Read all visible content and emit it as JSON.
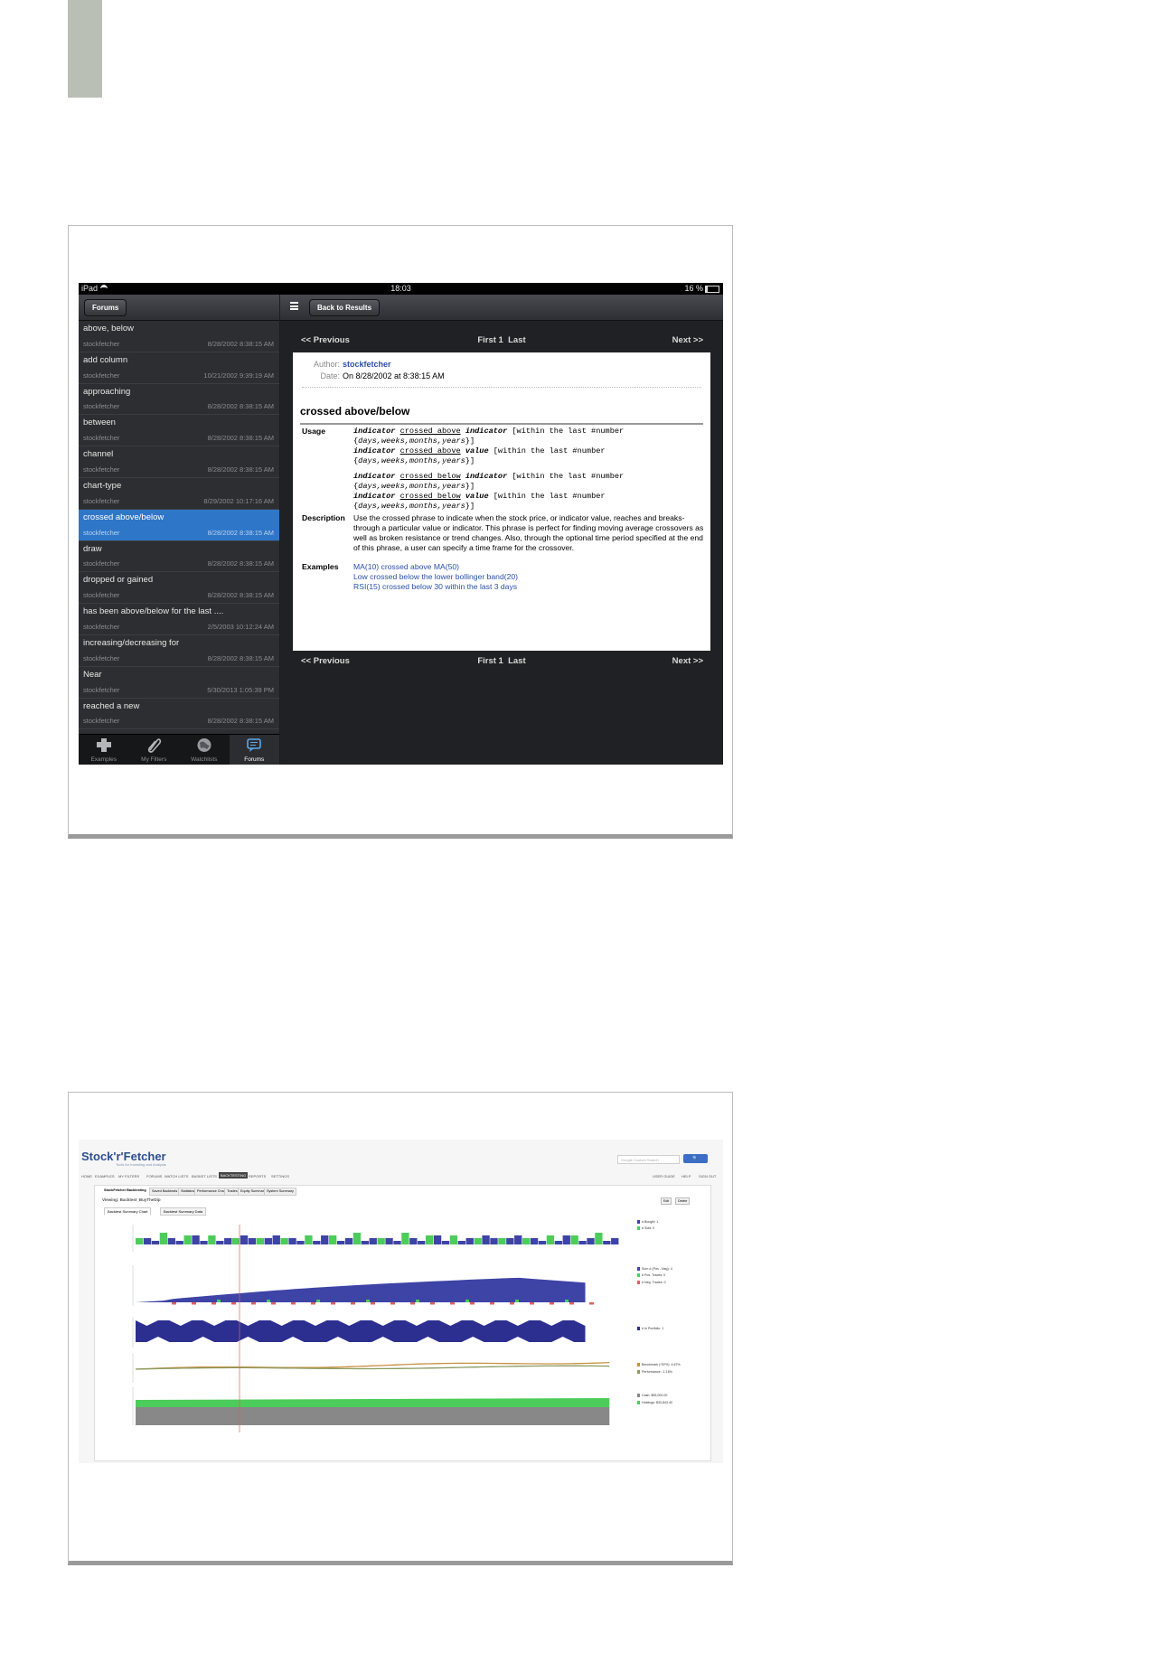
{
  "ipad": {
    "status": {
      "carrier": "iPad",
      "time": "18:03",
      "battery": "16 %"
    },
    "sidebar_header": "Forums",
    "back_button": "Back to Results",
    "items": [
      {
        "title": "above, below",
        "author": "stockfetcher",
        "date": "8/28/2002 8:38:15 AM"
      },
      {
        "title": "add column",
        "author": "stockfetcher",
        "date": "10/21/2002 9:39:19 AM"
      },
      {
        "title": "approaching",
        "author": "stockfetcher",
        "date": "8/28/2002 8:38:15 AM"
      },
      {
        "title": "between",
        "author": "stockfetcher",
        "date": "8/28/2002 8:38:15 AM"
      },
      {
        "title": "channel",
        "author": "stockfetcher",
        "date": "8/28/2002 8:38:15 AM"
      },
      {
        "title": "chart-type",
        "author": "stockfetcher",
        "date": "8/29/2002 10:17:16 AM"
      },
      {
        "title": "crossed above/below",
        "author": "stockfetcher",
        "date": "8/28/2002 8:38:15 AM"
      },
      {
        "title": "draw",
        "author": "stockfetcher",
        "date": "8/28/2002 8:38:15 AM"
      },
      {
        "title": "dropped or gained",
        "author": "stockfetcher",
        "date": "8/28/2002 8:38:15 AM"
      },
      {
        "title": "has been above/below for the last ....",
        "author": "stockfetcher",
        "date": "2/5/2003 10:12:24 AM"
      },
      {
        "title": "increasing/decreasing for",
        "author": "stockfetcher",
        "date": "8/28/2002 8:38:15 AM"
      },
      {
        "title": "Near",
        "author": "stockfetcher",
        "date": "5/30/2013 1:05:39 PM"
      },
      {
        "title": "reached a new",
        "author": "stockfetcher",
        "date": "8/28/2002 8:38:15 AM"
      }
    ],
    "tabs": [
      {
        "label": "Examples",
        "icon": "puzzle-icon"
      },
      {
        "label": "My Filters",
        "icon": "paperclip-icon"
      },
      {
        "label": "Watchlists",
        "icon": "globe-icon"
      },
      {
        "label": "Forums",
        "icon": "speech-bubble-icon"
      }
    ],
    "nav": {
      "previous": "<< Previous",
      "first": "First",
      "page": "1",
      "last": "Last",
      "next": "Next >>"
    },
    "post": {
      "author_label": "Author:",
      "author": "stockfetcher",
      "date_label": "Date:",
      "date": "On 8/28/2002 at 8:38:15 AM",
      "title": "crossed above/below",
      "usage_label": "Usage",
      "description_label": "Description",
      "description": "Use the crossed phrase to indicate when the stock price, or indicator value, reaches and breaks-through a particular value or indicator. This phrase is perfect for finding moving average crossovers as well as broken resistance or trend changes. Also, through the optional time period specified at the end of this phrase, a user can specify a time frame for the crossover.",
      "examples_label": "Examples",
      "examples": [
        "MA(10) crossed above MA(50)",
        "Low crossed below the lower bollinger band(20)",
        "RSI(15) crossed below 30 within the last 3 days"
      ]
    }
  },
  "stockfetcher": {
    "logo": "Stock'r'Fetcher",
    "tagline": "Tools for Investing and Analysis",
    "search_placeholder": "Google Custom Search",
    "nav": [
      "HOME",
      "EXAMPLES",
      "MY FILTERS",
      "FORUMS",
      "WATCH LISTS",
      "BASKET LISTS",
      "BACKTESTING",
      "REPORTS",
      "SETTINGS"
    ],
    "nav_right": [
      "USER GUIDE",
      "HELP",
      "SIGN OUT"
    ],
    "subtabs": [
      "StockFetcher Backtesting",
      "Saved Backtests",
      "Statistics",
      "Performance Chart",
      "Trades",
      "Equity Summary",
      "System Summary"
    ],
    "viewing": "Viewing: Backtest_BuyTheDip",
    "edit": "Edit",
    "delete": "Delete",
    "chart_tabs": [
      "Backtest Summary Chart",
      "Backtest Summary Data"
    ],
    "legends": [
      [
        "# Bought: 1",
        "# Sold: 0"
      ],
      [
        "Sum # (Pos - Neg): 4",
        "# Pos. Trades: 0",
        "# Neg. Trades: 0"
      ],
      [
        "# In Portfolio: 1"
      ],
      [
        "Benchmark (^SPX): 4.67%",
        "Performance: -1.16%"
      ],
      [
        "Cash: $95,000.00",
        "Holdings: $30,843.40"
      ]
    ],
    "colors": {
      "blue": "#3e43a6",
      "green": "#4ccc5a",
      "red": "#e06060",
      "navy": "#2c2f90",
      "orange": "#c89040",
      "olive": "#8a9a60",
      "gray": "#888888"
    }
  }
}
